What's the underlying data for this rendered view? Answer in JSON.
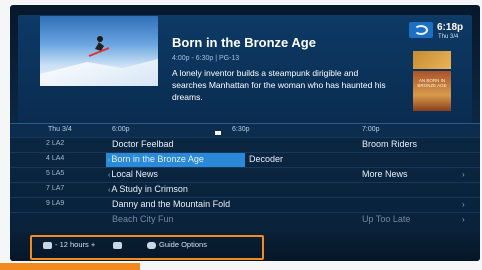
{
  "program": {
    "title": "Born in the Bronze Age",
    "meta": "4:00p - 6:30p | PG-13",
    "description": "A lonely inventor builds a steampunk dirigible and searches Manhattan for the woman who has haunted his dreams."
  },
  "status": {
    "time": "6:18p",
    "date": "Thu 3/4"
  },
  "poster": {
    "text": "AN BORN IN BRONZE AGE"
  },
  "timeline": {
    "day": "Thu 3/4",
    "slots": [
      "6:00p",
      "6:30p",
      "7:00p"
    ]
  },
  "guide": {
    "rows": [
      {
        "channel": "2 LA2",
        "programs": [
          "Doctor Feelbad",
          "Broom Riders"
        ]
      },
      {
        "channel": "4 LA4",
        "programs": [
          "Born in the Bronze Age",
          "Decoder"
        ],
        "selected": 0
      },
      {
        "channel": "5 LA5",
        "programs": [
          "Local News",
          "More News"
        ]
      },
      {
        "channel": "7 LA7",
        "programs": [
          "A Study in Crimson"
        ]
      },
      {
        "channel": "9 LA9",
        "programs": [
          "Danny and the Mountain Fold"
        ]
      },
      {
        "channel": "",
        "programs": [
          "Beach City Fun",
          "Up Too Late"
        ]
      }
    ]
  },
  "footer": {
    "jump_label": "- 12 hours +",
    "options_label": "Guide Options"
  },
  "icons": {
    "provider_logo": "directv-logo-icon",
    "chevron": "chevron-right-icon"
  },
  "colors": {
    "highlight": "#f28a1e",
    "selection": "#2a89d8"
  }
}
